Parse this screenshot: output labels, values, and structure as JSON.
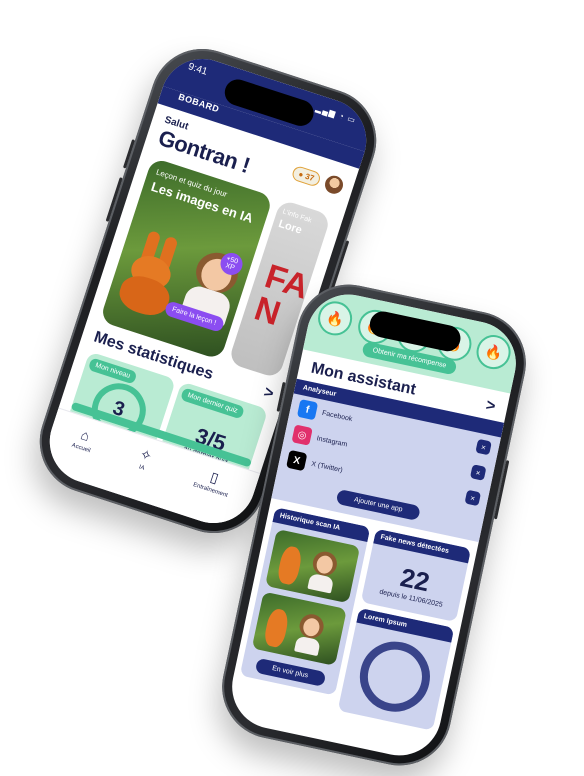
{
  "home": {
    "status_time": "9:41",
    "app_name": "BOBARD",
    "greeting_small": "Salut",
    "greeting_name": "Gontran !",
    "coins": "37",
    "lesson_card": {
      "kicker": "Leçon et quiz du jour",
      "title": "Les images en IA",
      "chip": "+50 XP",
      "cta": "Faire la leçon !"
    },
    "lesson_card2": {
      "kicker": "L'info Fak",
      "title": "Lore",
      "overlay": "FA N"
    },
    "stats_title": "Mes statistiques",
    "stats_arrow": ">",
    "level_card": {
      "label": "Mon niveau",
      "value": "3"
    },
    "quiz_card": {
      "label": "Mon dernier quiz",
      "value": "3/5",
      "sub": "au dernier quiz"
    },
    "nav": [
      {
        "label": "Accueil",
        "icon": "⌂"
      },
      {
        "label": "IA",
        "icon": "✧"
      },
      {
        "label": "Entraînement",
        "icon": "▯"
      }
    ]
  },
  "assistant": {
    "fires": [
      "🔥",
      "🔥",
      "🔥",
      "🔥",
      "🔥"
    ],
    "reward_button": "Obtenir ma récompense",
    "title": "Mon assistant",
    "title_arrow": ">",
    "analyser": {
      "header": "Analyseur",
      "apps": [
        {
          "name": "Facebook",
          "icon": "f",
          "color": "#1877f2"
        },
        {
          "name": "Instagram",
          "icon": "◎",
          "color": "#e1306c"
        },
        {
          "name": "X (Twitter)",
          "icon": "X",
          "color": "#000000"
        }
      ],
      "remove_label": "×",
      "add_button": "Ajouter une app"
    },
    "history": {
      "header": "Historique scan IA",
      "see_more": "En voir plus"
    },
    "fake_news": {
      "header": "Fake news détectées",
      "count": "22",
      "since": "depuis le 11/06/2025"
    },
    "lorem": {
      "header": "Lorem Ipsum"
    }
  },
  "colors": {
    "navy": "#1e2a78",
    "mint": "#b9ebd3",
    "green": "#46c295",
    "purple": "#8b4df1",
    "lavender": "#cdd3ee"
  }
}
